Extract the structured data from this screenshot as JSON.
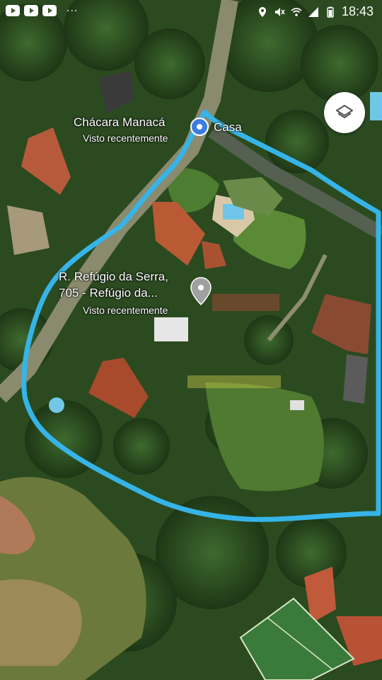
{
  "status_bar": {
    "time": "18:43",
    "left_icons": [
      "youtube-icon",
      "youtube-icon",
      "youtube-icon"
    ],
    "overflow": "...",
    "right_icons": [
      "location-icon",
      "mute-icon",
      "wifi-icon",
      "signal-icon",
      "battery-icon"
    ]
  },
  "places": [
    {
      "name": "Chácara Manacá",
      "subtitle": "Visto recentemente",
      "pin": "blue-location-pin"
    },
    {
      "name": "Casa"
    },
    {
      "name_line1": "R. Refúgio da Serra,",
      "name_line2": "705 - Refúgio da...",
      "subtitle": "Visto recentemente",
      "pin": "gray-location-pin"
    }
  ],
  "controls": {
    "layers_button": "layers-icon"
  },
  "annotation": {
    "color": "#36b4e8",
    "kind": "hand-drawn outline"
  }
}
